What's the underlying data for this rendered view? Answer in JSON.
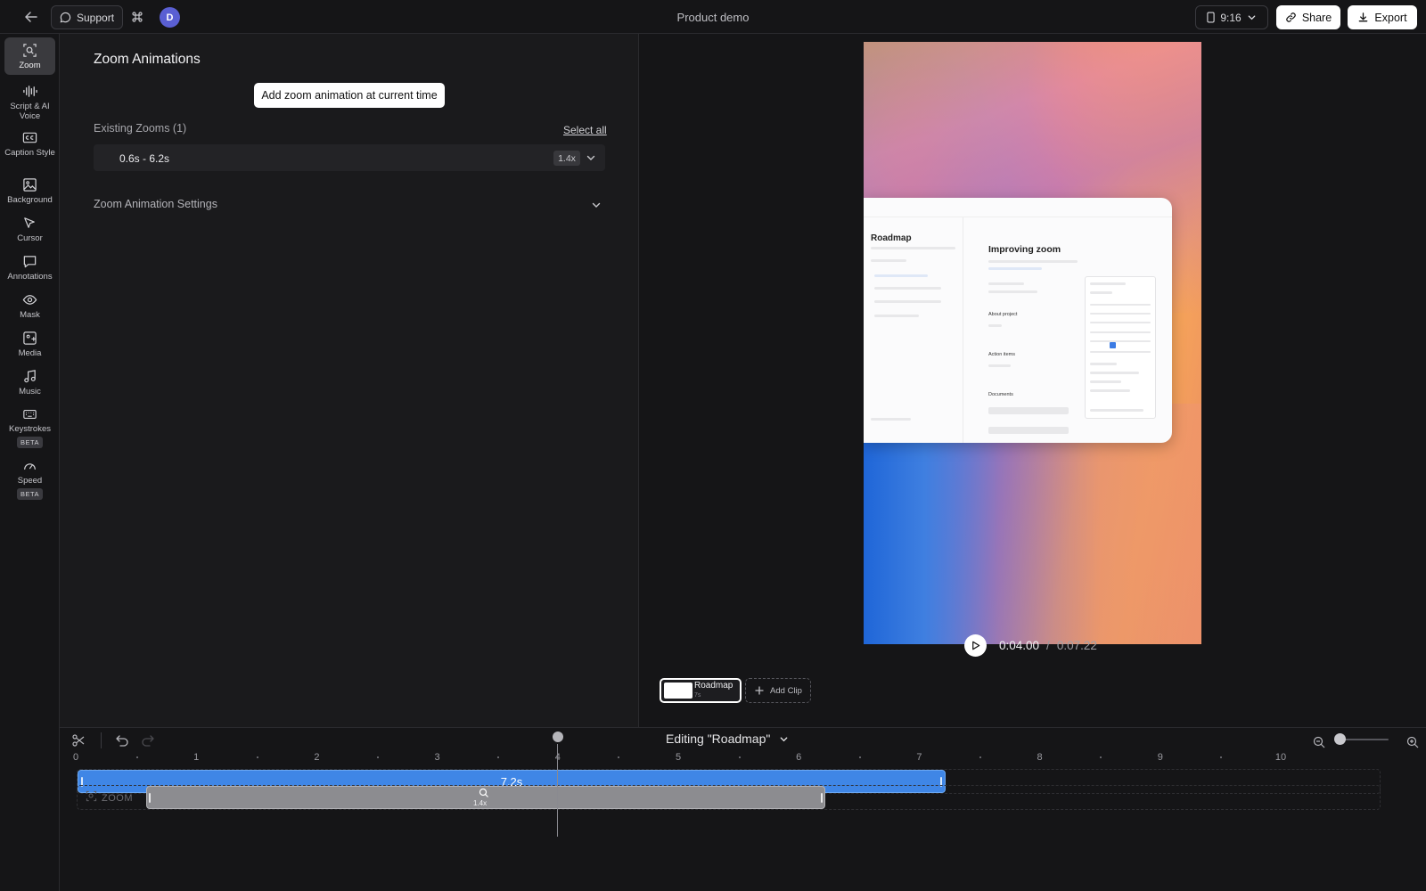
{
  "header": {
    "support_label": "Support",
    "avatar_initial": "D",
    "doc_title": "Product demo",
    "aspect_ratio": "9:16",
    "share_label": "Share",
    "export_label": "Export"
  },
  "rail": {
    "items": [
      {
        "label": "Zoom",
        "icon": "zoom-icon",
        "active": true
      },
      {
        "label": "Script & AI Voice",
        "icon": "waveform-icon"
      },
      {
        "label": "Caption Style",
        "icon": "captions-icon"
      },
      {
        "label": "Background",
        "icon": "image-icon"
      },
      {
        "label": "Cursor",
        "icon": "cursor-icon"
      },
      {
        "label": "Annotations",
        "icon": "chat-bubble-icon"
      },
      {
        "label": "Mask",
        "icon": "eye-icon"
      },
      {
        "label": "Media",
        "icon": "media-icon"
      },
      {
        "label": "Music",
        "icon": "music-note-icon"
      },
      {
        "label": "Keystrokes",
        "icon": "keyboard-icon",
        "badge": "BETA"
      },
      {
        "label": "Speed",
        "icon": "gauge-icon",
        "badge": "BETA"
      }
    ]
  },
  "panel": {
    "title": "Zoom Animations",
    "add_button": "Add zoom animation at current time",
    "existing_label": "Existing Zooms (1)",
    "select_all": "Select all",
    "zooms": [
      {
        "range": "0.6s - 6.2s",
        "level": "1.4x"
      }
    ],
    "settings_label": "Zoom Animation Settings"
  },
  "preview": {
    "screenshot": {
      "sidebar_title": "Roadmap",
      "page_title": "Improving zoom",
      "about_label": "About project",
      "action_items_label": "Action items",
      "documents_label": "Documents"
    },
    "time_current": "0:04.00",
    "time_separator": "/",
    "time_total": "0:07.22"
  },
  "clips": {
    "items": [
      {
        "name": "Roadmap",
        "duration": "7s"
      }
    ],
    "add_label": "Add Clip"
  },
  "timeline": {
    "editing_label": "Editing \"Roadmap\"",
    "ruler_labels": [
      "0",
      "1",
      "2",
      "3",
      "4",
      "5",
      "6",
      "7",
      "8",
      "9",
      "10"
    ],
    "video_track_label": "7.2s",
    "zoom_track_name": "ZOOM",
    "zoom_block_level": "1.4x",
    "playhead_time": 4
  },
  "colors": {
    "accent_blue": "#3f86e6",
    "zoom_block_gray": "#8c8c90",
    "background": "#151517",
    "panel": "#1a1a1c"
  }
}
